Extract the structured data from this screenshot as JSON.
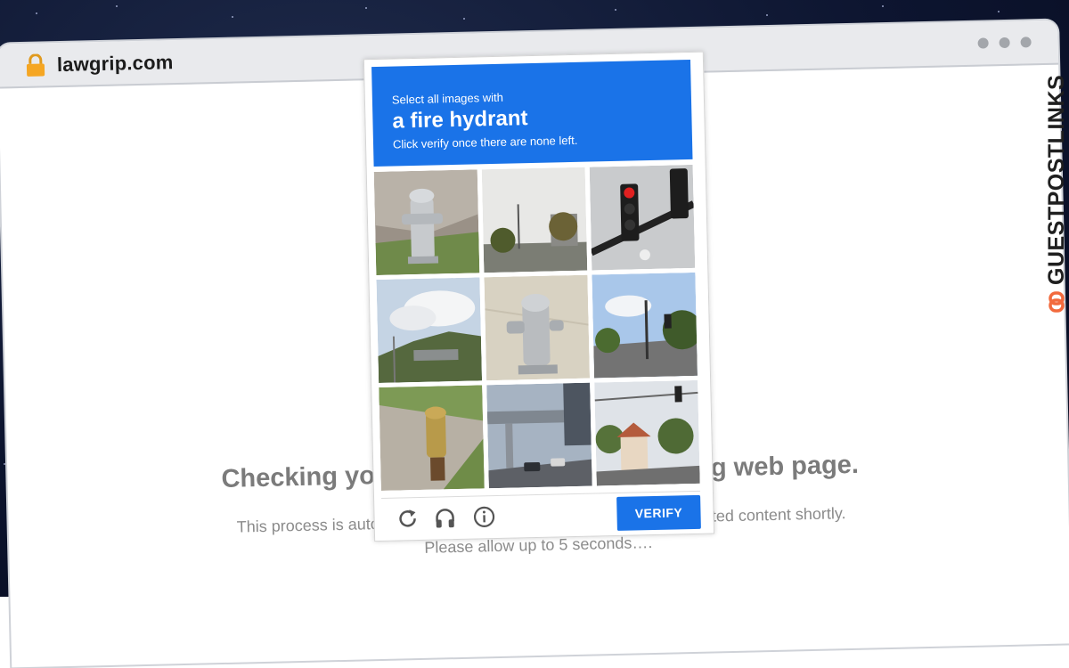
{
  "browser": {
    "url": "lawgrip.com"
  },
  "page": {
    "title": "Checking your browser before accessing web page.",
    "subtitle": "This process is automatic. Your browser will redirect to your requested content shortly.",
    "wait_text": "Please allow up to 5 seconds…."
  },
  "captcha": {
    "prompt_line1": "Select all images with",
    "prompt_target": "a fire hydrant",
    "prompt_line3": "Click verify once there are none left.",
    "verify_label": "VERIFY",
    "tiles": [
      {
        "subject": "fire hydrant on sidewalk"
      },
      {
        "subject": "street with trees"
      },
      {
        "subject": "traffic lights"
      },
      {
        "subject": "clouds and hills"
      },
      {
        "subject": "fire hydrant close-up"
      },
      {
        "subject": "street with traffic light"
      },
      {
        "subject": "fire hydrant on grass"
      },
      {
        "subject": "overpass and cars"
      },
      {
        "subject": "street with building"
      }
    ],
    "footer_icons": [
      "reload-icon",
      "headphones-icon",
      "info-icon"
    ],
    "accent_color": "#1a73e8"
  },
  "watermark": {
    "text": "GUESTPOSTLINKS",
    "logo_color": "#f26a3d"
  }
}
